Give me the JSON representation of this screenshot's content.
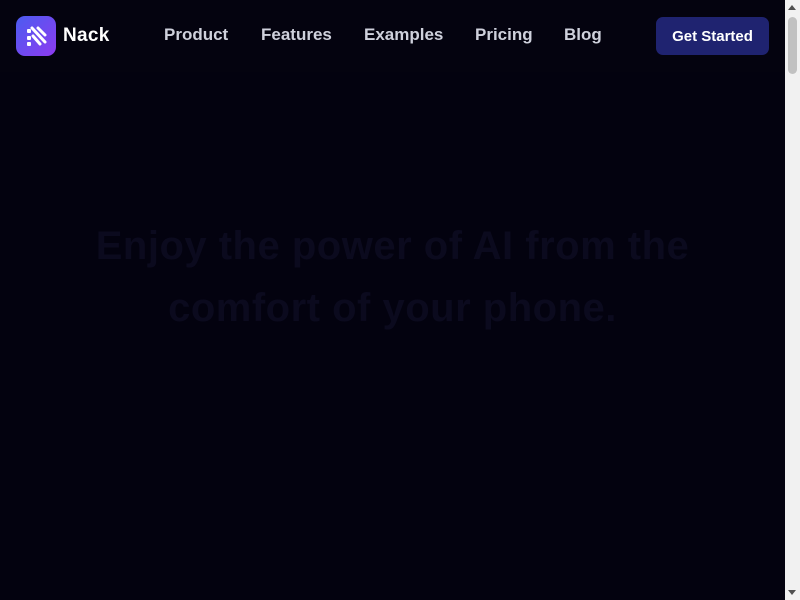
{
  "brand": {
    "name": "Nack",
    "icon": "nack-logo-icon",
    "gradient": [
      "#4b5cf0",
      "#8e3bf0"
    ]
  },
  "nav": {
    "links": [
      {
        "label": "Product"
      },
      {
        "label": "Features"
      },
      {
        "label": "Examples"
      },
      {
        "label": "Pricing"
      },
      {
        "label": "Blog"
      }
    ],
    "cta_label": "Get Started"
  },
  "hero": {
    "title_line1": "Enjoy the power of AI from the",
    "title_line2": "comfort of your phone."
  },
  "colors": {
    "background": "#03020f",
    "cta": "#1f2370",
    "nav_text": "#cfd1dc"
  }
}
